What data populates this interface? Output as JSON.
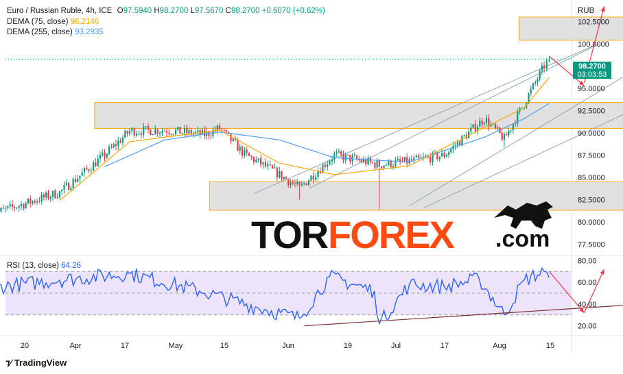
{
  "header": {
    "symbol": "Euro / Russian Ruble, 4h, ICE",
    "ohlc": [
      {
        "k": "O",
        "v": "97.5940"
      },
      {
        "k": "H",
        "v": "98.2700"
      },
      {
        "k": "L",
        "v": "97.5670"
      },
      {
        "k": "C",
        "v": "98.2700"
      }
    ],
    "change": "+0.6070 (+0.62%)",
    "currency": "RUB"
  },
  "indicators": {
    "dema75": {
      "label": "DEMA (75, close)",
      "value": "96.2146"
    },
    "dema255": {
      "label": "DEMA (255, close)",
      "value": "93.2935"
    },
    "rsi": {
      "label": "RSI (13, close)",
      "value": "64.26"
    }
  },
  "price_badge": {
    "price": "98.2700",
    "countdown": "03:03:53"
  },
  "watermark": {
    "tor": "TOR",
    "forex": "FOREX",
    "com": ".com"
  },
  "brand": "TradingView",
  "colors": {
    "up": "#089981",
    "down": "#f23645",
    "dema75": "#f7a600",
    "dema255": "#4f9df5",
    "rsi": "#2962ff",
    "zone_border": "#f7a600",
    "arrow": "#f23645"
  },
  "chart_data": [
    {
      "type": "candlestick",
      "title": "Euro / Russian Ruble, 4h, ICE",
      "y_ticks": [
        "102.5000",
        "100.0000",
        "97.5000",
        "95.0000",
        "92.5000",
        "90.0000",
        "87.5000",
        "85.0000",
        "82.5000",
        "80.0000",
        "77.5000"
      ],
      "ylim": [
        76.3,
        104.3
      ],
      "x_ticks": [
        "20",
        "Apr",
        "17",
        "May",
        "15",
        "Jun",
        "19",
        "Jul",
        "17",
        "Aug",
        "15"
      ],
      "key_points": [
        {
          "t": "Mar 13",
          "close": 80.8
        },
        {
          "t": "Mar 27",
          "close": 83.3
        },
        {
          "t": "Apr 5",
          "close": 87.5
        },
        {
          "t": "Apr 10",
          "close": 90.2
        },
        {
          "t": "Apr 17",
          "close": 90.3
        },
        {
          "t": "Apr 25",
          "close": 89.8
        },
        {
          "t": "Apr 28",
          "close": 90.5
        },
        {
          "t": "May 3",
          "close": 87.6
        },
        {
          "t": "May 10",
          "close": 85.3
        },
        {
          "t": "May 14",
          "close": 83.8
        },
        {
          "t": "May 21",
          "close": 87.5
        },
        {
          "t": "May 30",
          "close": 86.4
        },
        {
          "t": "Jun 5",
          "close": 86.8
        },
        {
          "t": "Jun 12",
          "close": 87.5
        },
        {
          "t": "Jun 20",
          "close": 91.6
        },
        {
          "t": "Jun 24",
          "close": 89.3
        },
        {
          "t": "Jun 28",
          "close": 93.3
        },
        {
          "t": "Jul 2",
          "close": 97.5
        },
        {
          "t": "Jul 3",
          "close": 98.27
        }
      ],
      "wick_extremes": [
        {
          "t": "Apr 28",
          "high": 91.1
        },
        {
          "t": "May 14",
          "low": 82.5
        },
        {
          "t": "May 30",
          "low": 81.4
        },
        {
          "t": "Jun 24",
          "low": 88.4
        },
        {
          "t": "Jul 3",
          "high": 98.6
        }
      ],
      "dema75_series": [
        {
          "t": "Mar 27",
          "v": 82.4
        },
        {
          "t": "Apr 10",
          "v": 89.0
        },
        {
          "t": "Apr 28",
          "v": 90.3
        },
        {
          "t": "May 10",
          "v": 86.6
        },
        {
          "t": "May 21",
          "v": 85.3
        },
        {
          "t": "Jun 5",
          "v": 86.3
        },
        {
          "t": "Jun 20",
          "v": 90.6
        },
        {
          "t": "Jun 28",
          "v": 92.8
        },
        {
          "t": "Jul 3",
          "v": 96.21
        }
      ],
      "dema255_series": [
        {
          "t": "Apr 5",
          "v": 86.2
        },
        {
          "t": "Apr 17",
          "v": 89.2
        },
        {
          "t": "Apr 28",
          "v": 90.1
        },
        {
          "t": "May 10",
          "v": 89.2
        },
        {
          "t": "May 21",
          "v": 87.2
        },
        {
          "t": "Jun 5",
          "v": 86.7
        },
        {
          "t": "Jun 20",
          "v": 89.5
        },
        {
          "t": "Jun 28",
          "v": 91.6
        },
        {
          "t": "Jul 3",
          "v": 93.29
        }
      ],
      "zones": [
        {
          "t0": "Jun 27",
          "t1": "Aug 10",
          "low": 100.4,
          "high": 103.0
        },
        {
          "t0": "Apr 3",
          "t1": "Aug 10",
          "low": 90.5,
          "high": 93.4
        },
        {
          "t0": "Apr 26",
          "t1": "Aug 11",
          "low": 81.3,
          "high": 84.5
        }
      ],
      "trendlines": [
        {
          "t0": "May 5",
          "v0": 83.2,
          "t1": "Jul 12",
          "v1": 99.8
        },
        {
          "t0": "May 16",
          "v0": 83.8,
          "t1": "Jul 13",
          "v1": 100.0
        },
        {
          "t0": "Jun 5",
          "v0": 81.8,
          "t1": "Jul 25",
          "v1": 98.7
        },
        {
          "t0": "Jun 8",
          "v0": 81.6,
          "t1": "Aug 8",
          "v1": 97.6
        }
      ],
      "arrows": [
        {
          "t0": "Jul 3",
          "v0": 98.6,
          "t1": "Jul 10",
          "v1": 95.3
        },
        {
          "t0": "Jul 10",
          "v0": 95.6,
          "t1": "Jul 14",
          "v1": 104.2
        }
      ],
      "last_price": 98.27
    },
    {
      "type": "line",
      "title": "RSI (13, close)",
      "y_ticks": [
        "80.00",
        "60.00",
        "40.00",
        "20.00"
      ],
      "ylim": [
        11,
        84
      ],
      "band": [
        30,
        70
      ],
      "key_points": [
        {
          "t": "Mar 13",
          "v": 55
        },
        {
          "t": "Mar 27",
          "v": 62
        },
        {
          "t": "Apr 10",
          "v": 68
        },
        {
          "t": "Apr 24",
          "v": 52
        },
        {
          "t": "May 7",
          "v": 35
        },
        {
          "t": "May 14",
          "v": 27
        },
        {
          "t": "May 20",
          "v": 65
        },
        {
          "t": "May 29",
          "v": 52
        },
        {
          "t": "May 30",
          "v": 22
        },
        {
          "t": "Jun 5",
          "v": 58
        },
        {
          "t": "Jun 12",
          "v": 56
        },
        {
          "t": "Jun 19",
          "v": 63
        },
        {
          "t": "Jun 24",
          "v": 30
        },
        {
          "t": "Jun 28",
          "v": 62
        },
        {
          "t": "Jul 2",
          "v": 70
        },
        {
          "t": "Jul 3",
          "v": 64.26
        }
      ],
      "trendlines": [
        {
          "t0": "May 15",
          "v0": 20,
          "t1": "Aug 1",
          "v1": 43
        }
      ],
      "arrows": [
        {
          "t0": "Jul 3",
          "v0": 70,
          "t1": "Jul 10",
          "v1": 32
        },
        {
          "t0": "Jul 10",
          "v0": 32,
          "t1": "Jul 14",
          "v1": 72
        }
      ]
    }
  ]
}
